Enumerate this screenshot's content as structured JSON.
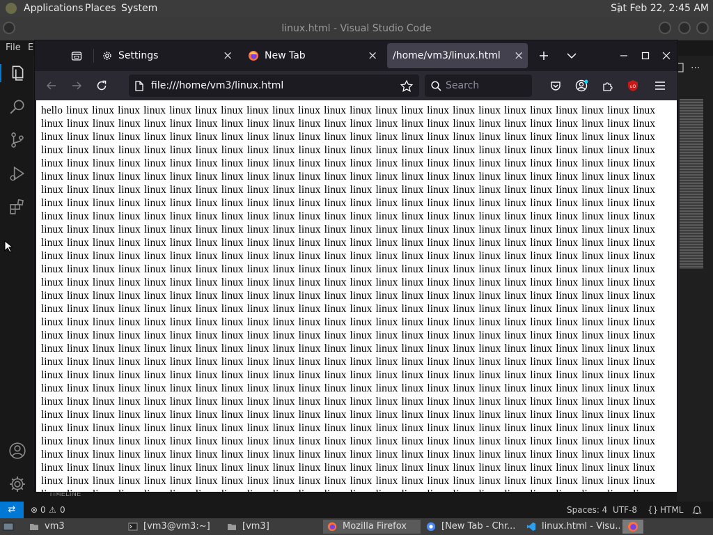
{
  "top_panel": {
    "menus": [
      "Applications",
      "Places",
      "System"
    ],
    "clock": "Sat Feb 22,  2:45 AM"
  },
  "vscode": {
    "window_title": "linux.html - Visual Studio Code",
    "menubar": [
      "File",
      "E"
    ],
    "timeline_label": "TIMELINE",
    "status": {
      "problems_errors": "0",
      "problems_warnings": "0",
      "spaces": "Spaces: 4",
      "encoding": "UTF-8",
      "language": "HTML",
      "language_braces": "{}"
    },
    "more_label": "..."
  },
  "firefox": {
    "tabs": [
      {
        "label": "Settings",
        "icon": "gear-icon"
      },
      {
        "label": "New Tab",
        "icon": "firefox-icon"
      },
      {
        "label": "/home/vm3/linux.html",
        "active": true
      }
    ],
    "url": "file:///home/vm3/linux.html",
    "search_placeholder": "Search",
    "page": {
      "first_word": "hello",
      "repeated_word": "linux"
    }
  },
  "taskbar": {
    "items": [
      {
        "label": "vm3",
        "icon": "folder-icon"
      },
      {
        "label": "[vm3@vm3:~]",
        "icon": "terminal-icon"
      },
      {
        "label": "[vm3]",
        "icon": "folder-icon"
      },
      {
        "label": "Mozilla Firefox",
        "icon": "firefox-icon",
        "active": true
      },
      {
        "label": "[New Tab - Chr...",
        "icon": "chrome-icon"
      },
      {
        "label": "linux.html - Visu...",
        "icon": "vscode-icon"
      }
    ]
  },
  "colors": {
    "accent": "#0078d4",
    "firefox_bg": "#1c1b22",
    "firefox_toolbar": "#2b2a33",
    "ublock": "#c41a1a"
  }
}
